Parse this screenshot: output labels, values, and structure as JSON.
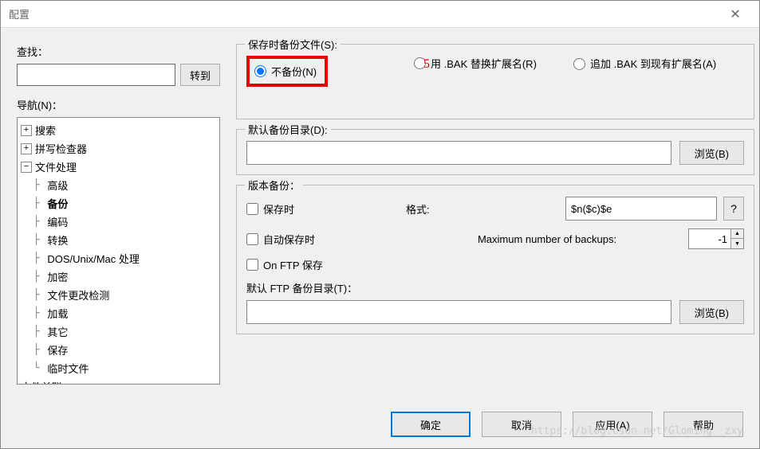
{
  "titlebar": {
    "title": "配置",
    "close": "✕"
  },
  "left": {
    "find_label": "查找：",
    "goto_btn": "转到",
    "nav_label": "导航(N)：",
    "tree": {
      "search": "搜索",
      "spell": "拼写检查器",
      "file_handling": "文件处理",
      "advanced": "高级",
      "backup": "备份",
      "encoding": "编码",
      "convert": "转换",
      "dos_unix_mac": "DOS/Unix/Mac 处理",
      "encrypt": "加密",
      "change_detect": "文件更改检测",
      "loading": "加载",
      "other": "其它",
      "save": "保存",
      "temp": "临时文件",
      "file_assoc": "文件关联"
    }
  },
  "right": {
    "backup_group_label": "保存时备份文件(S):",
    "radio_no_backup": "不备份(N)",
    "radio_bak_ext": "用 .BAK 替换扩展名(R)",
    "radio_append_bak": "追加 .BAK 到现有扩展名(A)",
    "default_dir_label": "默认备份目录(D):",
    "browse_btn": "浏览(B)",
    "version_group_label": "版本备份：",
    "cb_on_save": "保存时",
    "cb_on_autosave": "自动保存时",
    "cb_on_ftp": "On FTP 保存",
    "format_label": "格式:",
    "format_value": "$n($c)$e",
    "help_btn": "?",
    "max_backups_label": "Maximum number of backups:",
    "max_backups_value": "-1",
    "ftp_dir_label": "默认 FTP 备份目录(T)："
  },
  "footer": {
    "ok": "确定",
    "cancel": "取消",
    "apply": "应用(A)",
    "help": "帮助"
  },
  "annotation": {
    "num": "5"
  },
  "watermark": "https://blog.csdn.net/Gloming__zxy"
}
